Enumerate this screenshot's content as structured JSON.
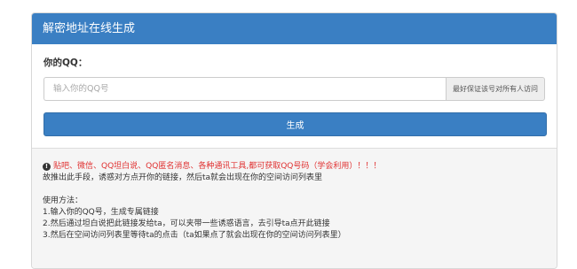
{
  "panel": {
    "title": "解密地址在线生成"
  },
  "form": {
    "label": "你的QQ：",
    "input_placeholder": "输入你的QQ号",
    "input_value": "",
    "addon_text": "最好保证该号对所有人访问",
    "generate_label": "生成"
  },
  "info": {
    "warning": "贴吧、微信、QQ坦白说、QQ匿名消息、各种通讯工具,都可获取QQ号码（学会利用）！！！",
    "description": "故推出此手段，诱惑对方点开你的链接，然后ta就会出现在你的空间访问列表里",
    "usage_title": "使用方法：",
    "steps": [
      "1.输入你的QQ号，生成专属链接",
      "2.然后通过坦白说把此链接发给ta，可以夹带一些诱惑语言，去引导ta点开此链接",
      "3.然后在空间访问列表里等待ta的点击（ta如果点了就会出现在你的空间访问列表里）"
    ]
  },
  "colors": {
    "header_bg": "#3a7fc3",
    "button_bg": "#3a7fc3",
    "warning_text": "#e03030",
    "info_bg": "#f5f5f5"
  },
  "icons": {
    "warning_icon": "info-circle-icon"
  }
}
